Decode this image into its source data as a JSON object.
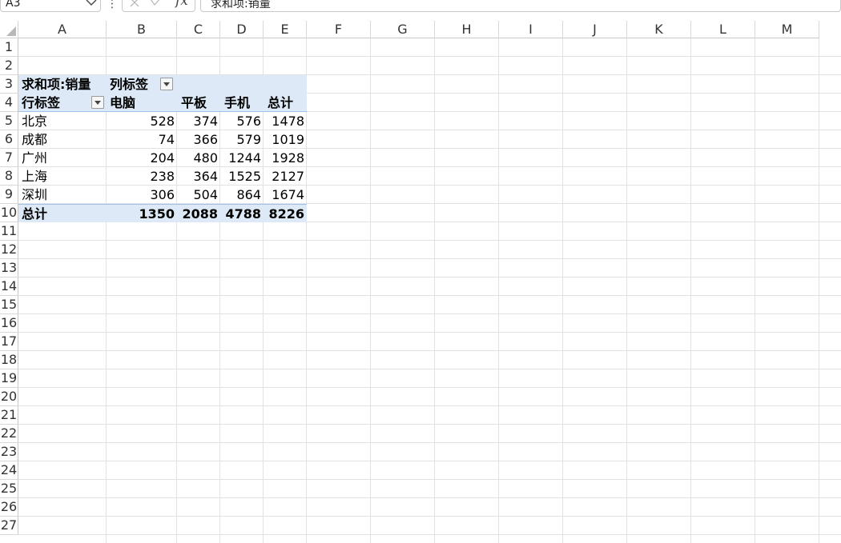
{
  "formula_bar": {
    "name_box": "A3",
    "formula": "求和项:销量",
    "fx_label": "fx",
    "more_icon": "⋮"
  },
  "columns": [
    "A",
    "B",
    "C",
    "D",
    "E",
    "F",
    "G",
    "H",
    "I",
    "J",
    "K",
    "L",
    "M"
  ],
  "rows": [
    "1",
    "2",
    "3",
    "4",
    "5",
    "6",
    "7",
    "8",
    "9",
    "10",
    "11",
    "12",
    "13",
    "14",
    "15",
    "16",
    "17",
    "18",
    "19",
    "20",
    "21",
    "22",
    "23",
    "24",
    "25",
    "26",
    "27"
  ],
  "pivot": {
    "value_field": "求和项:销量",
    "column_labels": "列标签",
    "row_labels": "行标签",
    "categories": [
      "电脑",
      "平板",
      "手机",
      "总计"
    ],
    "data_rows": [
      {
        "city": "北京",
        "values": [
          "528",
          "374",
          "576",
          "1478"
        ]
      },
      {
        "city": "成都",
        "values": [
          "74",
          "366",
          "579",
          "1019"
        ]
      },
      {
        "city": "广州",
        "values": [
          "204",
          "480",
          "1244",
          "1928"
        ]
      },
      {
        "city": "上海",
        "values": [
          "238",
          "364",
          "1525",
          "2127"
        ]
      },
      {
        "city": "深圳",
        "values": [
          "306",
          "504",
          "864",
          "1674"
        ]
      }
    ],
    "total_label": "总计",
    "totals": [
      "1350",
      "2088",
      "4788",
      "8226"
    ]
  },
  "colors": {
    "pivot_band": "#dde9f6",
    "pivot_border": "#9ec3e6",
    "gridline": "#e2e2e2"
  }
}
